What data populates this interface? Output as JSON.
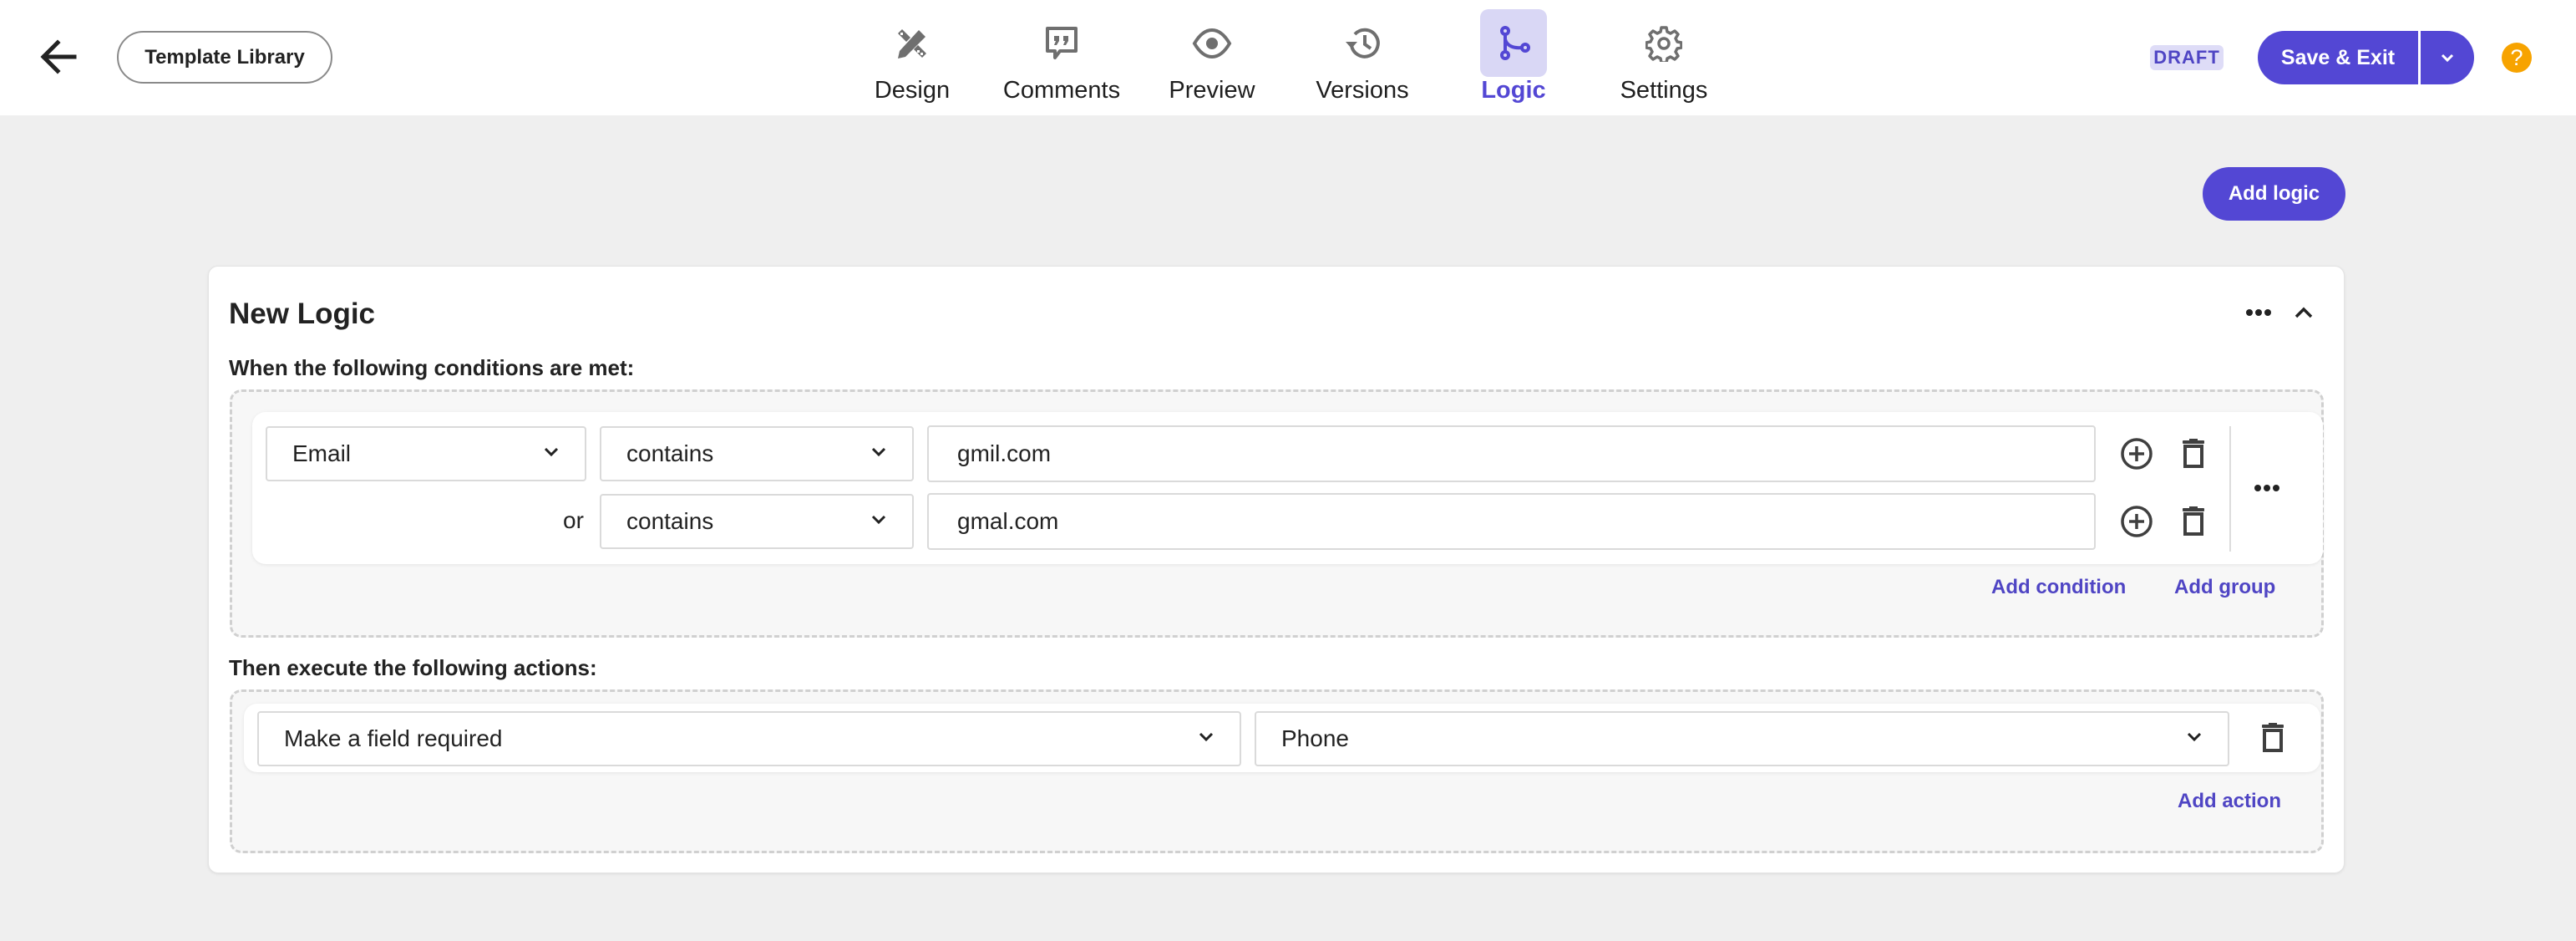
{
  "header": {
    "back_icon": "arrow-left-icon",
    "template_library_label": "Template Library",
    "nav": [
      {
        "label": "Design",
        "icon": "design-tools-icon",
        "active": false
      },
      {
        "label": "Comments",
        "icon": "comment-quote-icon",
        "active": false
      },
      {
        "label": "Preview",
        "icon": "eye-icon",
        "active": false
      },
      {
        "label": "Versions",
        "icon": "history-icon",
        "active": false
      },
      {
        "label": "Logic",
        "icon": "branch-icon",
        "active": true
      },
      {
        "label": "Settings",
        "icon": "gear-icon",
        "active": false
      }
    ],
    "status_badge": "DRAFT",
    "save_exit_label": "Save & Exit",
    "help_label": "?"
  },
  "toolbar": {
    "add_logic_label": "Add logic"
  },
  "logic": {
    "title": "New Logic",
    "conditions_heading": "When the following conditions are met:",
    "conditions": {
      "field": "Email",
      "connector": "or",
      "rows": [
        {
          "operator": "contains",
          "value": "gmil.com"
        },
        {
          "operator": "contains",
          "value": "gmal.com"
        }
      ],
      "add_condition_label": "Add condition",
      "add_group_label": "Add group"
    },
    "actions_heading": "Then execute the following actions:",
    "actions": [
      {
        "action": "Make a field required",
        "target": "Phone"
      }
    ],
    "add_action_label": "Add action"
  },
  "colors": {
    "accent": "#5347d4",
    "accent_light": "#d9d7f5",
    "help": "#f7a300",
    "background": "#efefef"
  }
}
